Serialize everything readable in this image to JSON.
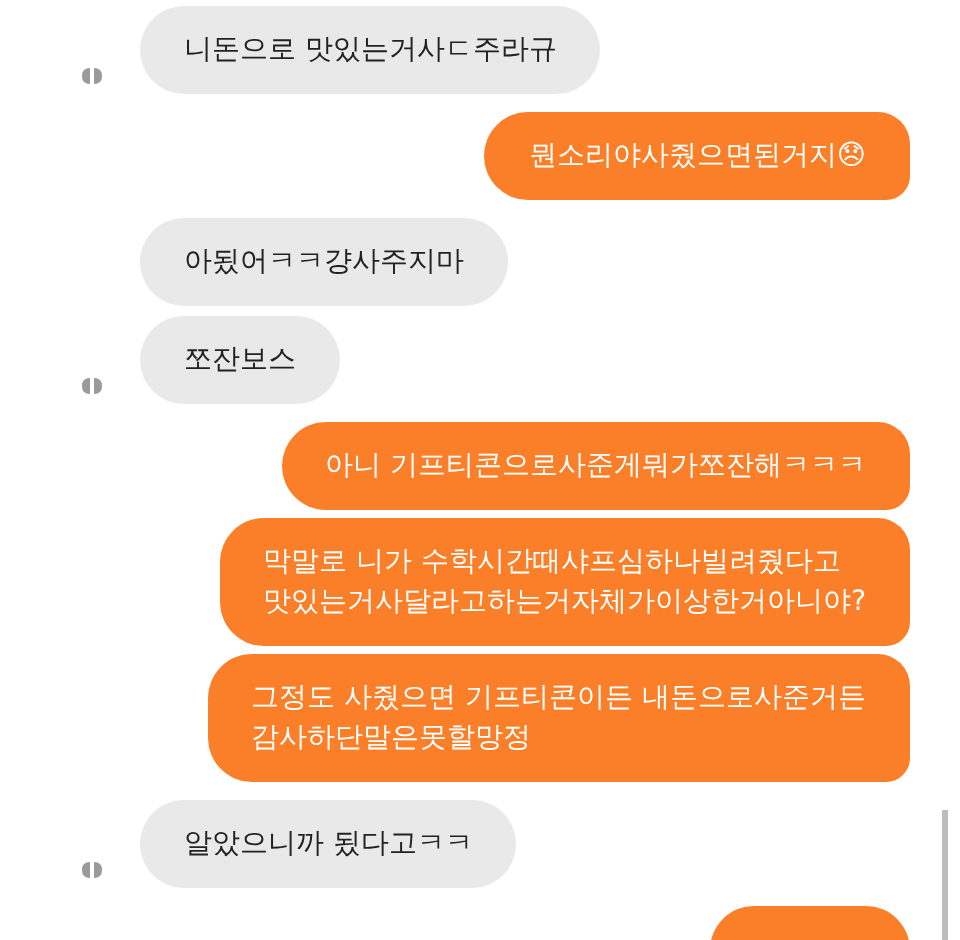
{
  "messages": [
    {
      "kind": "received",
      "avatar": true,
      "text": "니돈으로 맛있는거사ㄷ주라규"
    },
    {
      "kind": "sent",
      "text": "뭔소리야사줬으면된거지😞"
    },
    {
      "kind": "received",
      "avatar": false,
      "text": "아됬어ㅋㅋ걍사주지마"
    },
    {
      "kind": "received",
      "avatar": true,
      "text": "쪼잔보스"
    },
    {
      "kind": "sent",
      "text": "아니 기프티콘으로사준게뭐가쪼잔해ㅋㅋㅋ"
    },
    {
      "kind": "sent",
      "text": "막말로 니가 수학시간때샤프심하나빌려줬다고\n맛있는거사달라고하는거자체가이상한거아니야?"
    },
    {
      "kind": "sent",
      "text": "그정도 사줬으면 기프티콘이든 내돈으로사준거든\n감사하단말은못할망정"
    },
    {
      "kind": "received",
      "avatar": true,
      "text": "알았으니까 됬다고ㅋㅋ"
    },
    {
      "kind": "sent"
    }
  ]
}
